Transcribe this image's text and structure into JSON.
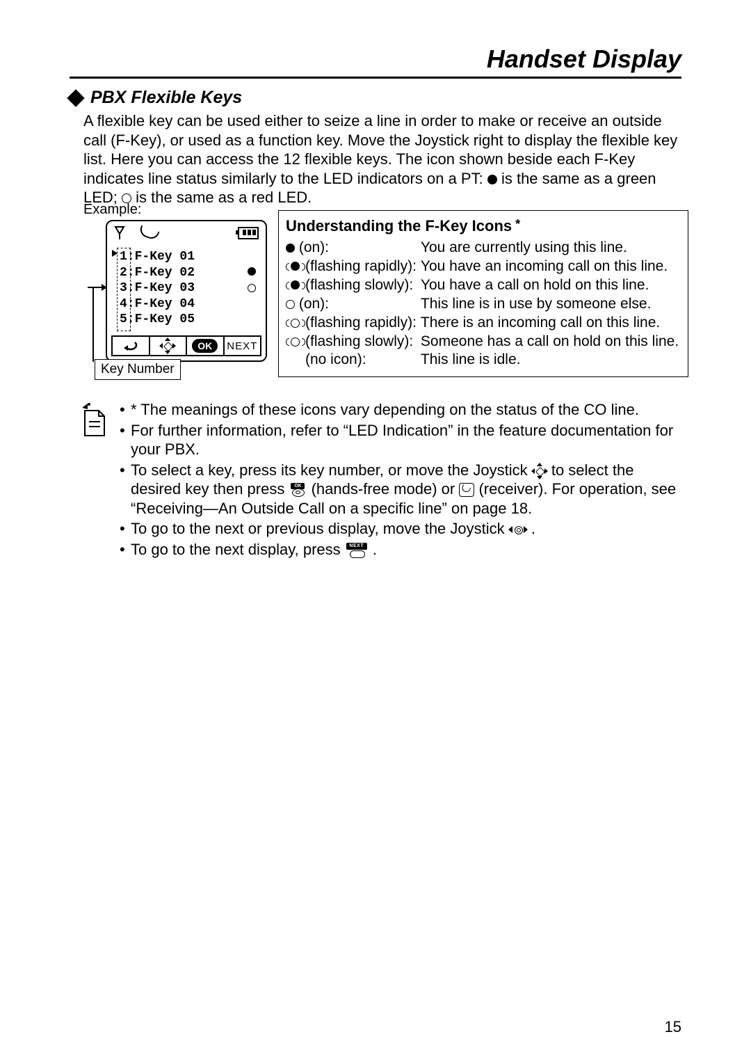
{
  "header": "Handset Display",
  "section_title": "PBX Flexible Keys",
  "intro_part1": "A flexible key can be used either to seize a line in order to make or receive an outside call (F-Key), or used as a function key. Move the Joystick right to display the flexible key list. Here you can access the 12 flexible keys. The icon shown beside each F-Key indicates line status similarly to the LED indicators on a PT: ",
  "intro_mid1": " is the same as a green LED; ",
  "intro_part2": " is the same as a red LED.",
  "example_label": "Example:",
  "fkeys": {
    "r1": "1:F-Key 01",
    "r2": "2:F-Key 02",
    "r3": "3:F-Key 03",
    "r4": "4:F-Key 04",
    "r5": "5:F-Key 05"
  },
  "softkeys": {
    "ok": "OK",
    "next": "NEXT"
  },
  "keynum_label": "Key Number",
  "understand": {
    "title": "Understanding the F-Key Icons",
    "rows": {
      "r0l": " (on):",
      "r0r": "You are currently using this line.",
      "r1l": "(flashing rapidly):",
      "r1r": "You have an incoming call on this line.",
      "r2l": "(flashing slowly):",
      "r2r": "You have a call on hold on this line.",
      "r3l": " (on):",
      "r3r": "This line is in use by someone else.",
      "r4l": "(flashing rapidly):",
      "r4r": "There is an incoming call on this line.",
      "r5l": "(flashing slowly):",
      "r5r": "Someone has a call on hold on this line.",
      "r6l": "(no icon):",
      "r6r": "This line is idle."
    }
  },
  "notes": {
    "n0": "* The meanings of these icons vary depending on the status of the CO line.",
    "n1": "For further information, refer to “LED Indication” in the feature documentation for your PBX.",
    "n2a": "To select a key, press its key number, or move the Joystick ",
    "n2b": " to select the desired key then press ",
    "n2c": " (hands-free mode) or ",
    "n2d": " (receiver). For operation, see “Receiving—An Outside Call on a specific line” on page 18.",
    "n3a": "To go to the next or previous display, move the Joystick ",
    "n3b": ".",
    "n4a": "To go to the next display, press ",
    "n4b": "."
  },
  "page_number": "15",
  "icon_labels": {
    "ok_small": "OK",
    "next_small": "NEXT"
  }
}
